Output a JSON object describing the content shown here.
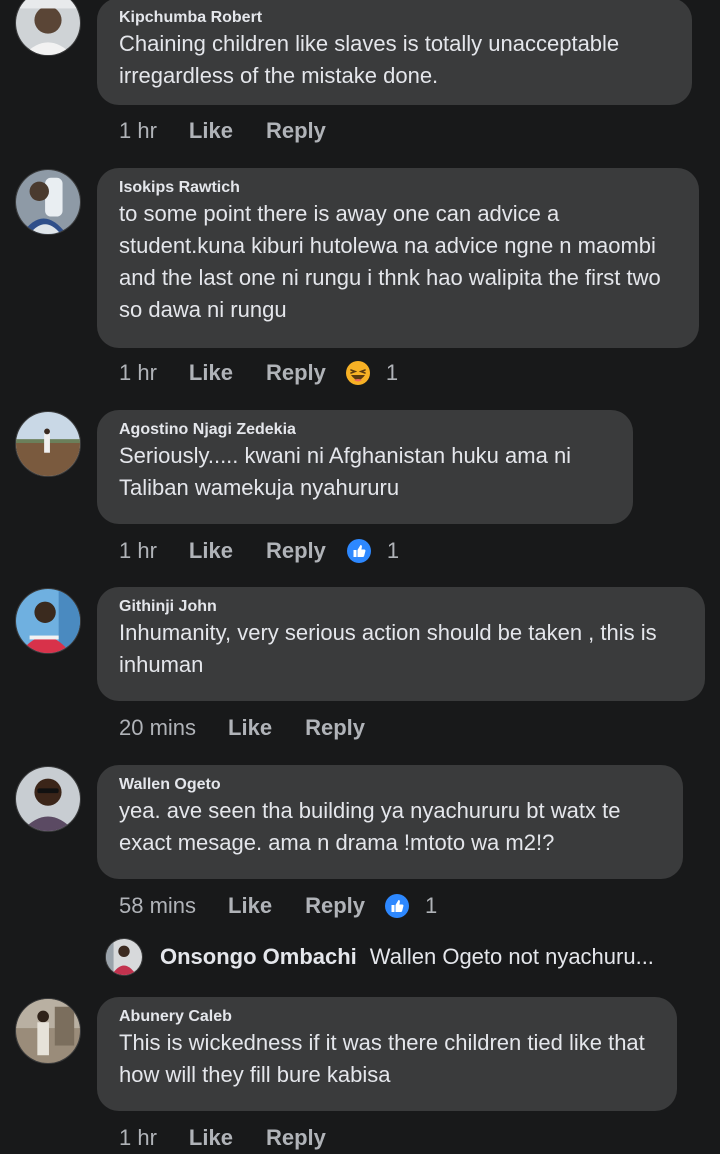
{
  "comments": [
    {
      "author": "Kipchumba Robert",
      "text": "Chaining children like slaves is totally unacceptable irregardless of the mistake done.",
      "time": "1 hr",
      "like": "Like",
      "reply": "Reply"
    },
    {
      "author": "Isokips Rawtich",
      "text": "to some point there is away one can advice a student.kuna kiburi hutolewa na advice ngne n maombi and the last one ni rungu i thnk hao walipita the first two so dawa ni rungu",
      "time": "1 hr",
      "like": "Like",
      "reply": "Reply",
      "reaction": {
        "icon": "haha-emoji-icon",
        "count": "1",
        "color": "#f7b125"
      }
    },
    {
      "author": "Agostino Njagi Zedekia",
      "text": "Seriously..... kwani ni Afghanistan huku ama ni Taliban wamekuja nyahururu",
      "time": "1 hr",
      "like": "Like",
      "reply": "Reply",
      "reaction": {
        "icon": "like-thumb-icon",
        "count": "1",
        "color": "#2d88ff"
      }
    },
    {
      "author": "Githinji John",
      "text": "Inhumanity, very serious action should be taken , this is inhuman",
      "time": "20 mins",
      "like": "Like",
      "reply": "Reply"
    },
    {
      "author": "Wallen Ogeto",
      "text": "yea. ave seen tha building ya nyachururu bt watx te exact mesage. ama n drama !mtoto wa m2!?",
      "time": "58 mins",
      "like": "Like",
      "reply": "Reply",
      "reaction": {
        "icon": "like-thumb-icon",
        "count": "1",
        "color": "#2d88ff"
      }
    },
    {
      "author": "Abunery Caleb",
      "text": "This is wickedness if it was there children tied like that how will they fill bure kabisa",
      "time": "1 hr",
      "like": "Like",
      "reply": "Reply"
    }
  ],
  "reply_preview": {
    "author": "Onsongo Ombachi",
    "text": "Wallen Ogeto not nyachuru..."
  },
  "colors": {
    "background": "#18191a",
    "bubble": "#3a3b3c",
    "primary_text": "#e4e6eb",
    "secondary_text": "#b0b3b8",
    "like_blue": "#2d88ff",
    "haha_yellow": "#f7b125"
  }
}
